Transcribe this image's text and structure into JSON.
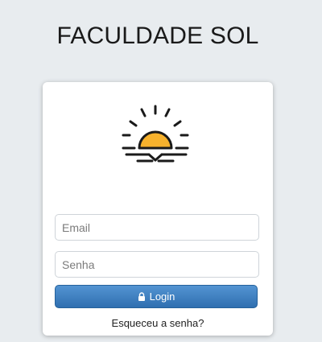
{
  "header": {
    "title": "FACULDADE SOL"
  },
  "logo": {
    "icon": "sunset-icon",
    "sun_color": "#f7b22d",
    "line_color": "#1a1a1a"
  },
  "form": {
    "email_placeholder": "Email",
    "email_value": "",
    "password_placeholder": "Senha",
    "password_value": "",
    "login_label": "Login",
    "login_icon": "lock-icon",
    "forgot_label": "Esqueceu a senha?",
    "button_color": "#3b7dc0"
  }
}
